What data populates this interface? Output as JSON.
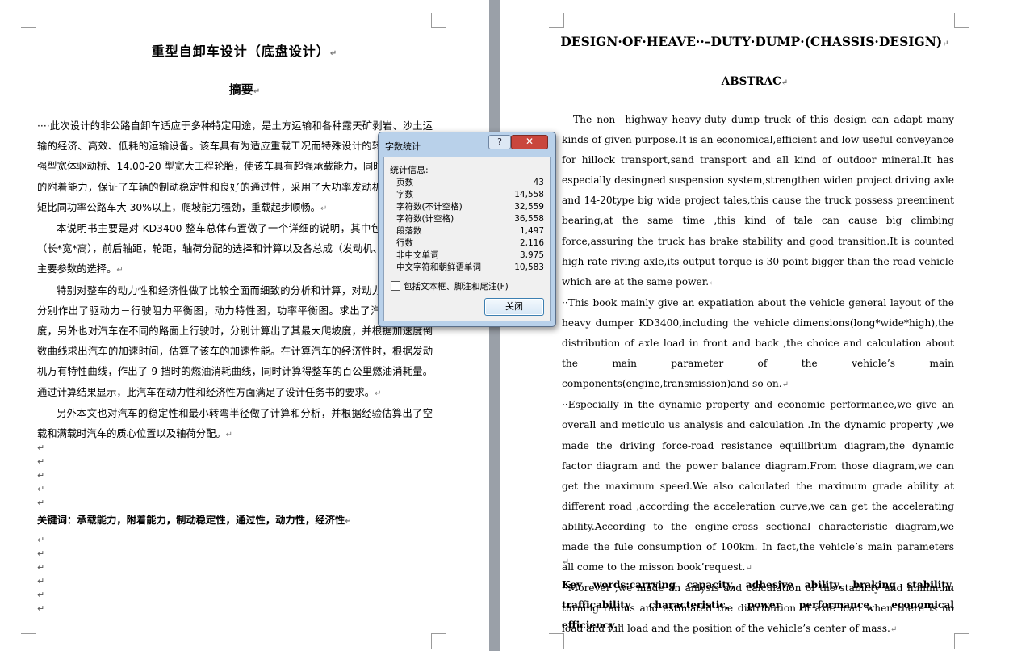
{
  "left_page": {
    "title": "重型自卸车设计（底盘设计）",
    "abstract_heading": "摘要",
    "paragraphs": [
      "····此次设计的非公路自卸车适应于多种特定用途，是土方运输和各种露天矿剥岩、沙土运输的经济、高效、低耗的运输设备。该车具有为适应重载工况而特殊设计的转向系统、加强型宽体驱动桥、14.00-20 型宽大工程轮胎，使该车具有超强承载能力，同时提供了超强的附着能力，保证了车辆的制动稳定性和良好的通过性，采用了大功率发动机，其输出转矩比同功率公路车大 30%以上，爬坡能力强劲，重载起步顺畅。",
      "本说明书主要是对 KD3400 整车总体布置做了一个详细的说明，其中包括整车尺寸（长*宽*高），前后轴距，轮距，轴荷分配的选择和计算以及各总成（发动机、传动系）的主要参数的选择。",
      "特别对整车的动力性和经济性做了比较全面而细致的分析和计算，对动力性计算时，分别作出了驱动力－行驶阻力平衡图，动力特性图，功率平衡图。求出了汽车的最大速度，另外也对汽车在不同的路面上行驶时，分别计算出了其最大爬坡度，并根据加速度倒数曲线求出汽车的加速时间，估算了该车的加速性能。在计算汽车的经济性时，根据发动机万有特性曲线，作出了 9 挡时的燃油消耗曲线，同时计算得整车的百公里燃油消耗量。通过计算结果显示，此汽车在动力性和经济性方面满足了设计任务书的要求。",
      "另外本文也对汽车的稳定性和最小转弯半径做了计算和分析，并根据经验估算出了空载和满载时汽车的质心位置以及轴荷分配。"
    ],
    "keywords": "关键词：承载能力，附着能力，制动稳定性，通过性，动力性，经济性"
  },
  "right_page": {
    "title": "DESIGN·OF·HEAVE··–DUTY·DUMP·(CHASSIS·DESIGN)",
    "abstract_heading": "ABSTRAC",
    "paragraphs": [
      "The non –highway heavy-duty dump truck of this design can adapt many kinds of given purpose.It is an economical,efficient and low useful conveyance for hillock transport,sand transport and all kind of outdoor mineral.It has especially desingned suspension system,strengthen widen project driving axle and 14-20type big wide project tales,this cause the truck possess preeminent bearing,at the same time ,this kind of tale can cause big climbing force,assuring the truck has brake stability and good transition.It is counted high rate riving axle,its output torque is 30 point bigger than the road vehicle which are at the same power.",
      "··This book mainly give an expatiation about the vehicle general layout of the heavy dumper KD3400,including the vehicle dimensions(long*wide*high),the distribution of axle load in front and back ,the choice and calculation about the main parameter of the vehicle’s main components(engine,transmission)and so on.",
      "··Especially in the dynamic property and economic performance,we give an overall and meticulo us analysis and calculation .In the dynamic property ,we made the driving force-road resistance equilibrium diagram,the dynamic factor diagram and the power balance diagram.From those diagram,we can get the maximum speed.We also calculated the maximum grade ability at different road ,according the acceleration curve,we can get the accelerating ability.According to the engine-cross sectional characteristic diagram,we made the fule consumption of 100km. In fact,the vehicle’s main parameters all come to the misson book’request.",
      "··Morever ,we made an anlysis and calculation of the stability and minimum turning radius and estimated the distribution of axle load when there is no load and full load and the position of the vehicle’s center of mass."
    ],
    "keywords": "Key words:carrying capacity, adhesive ability, braking stability, trafficability characteristic, power performance, economical efficiency."
  },
  "dialog": {
    "title": "字数统计",
    "help_label": "?",
    "close_x": "✕",
    "section": "统计信息:",
    "stats": [
      {
        "label": "页数",
        "value": "43"
      },
      {
        "label": "字数",
        "value": "14,558"
      },
      {
        "label": "字符数(不计空格)",
        "value": "32,559"
      },
      {
        "label": "字符数(计空格)",
        "value": "36,558"
      },
      {
        "label": "段落数",
        "value": "1,497"
      },
      {
        "label": "行数",
        "value": "2,116"
      },
      {
        "label": "非中文单词",
        "value": "3,975"
      },
      {
        "label": "中文字符和朝鲜语单词",
        "value": "10,583"
      }
    ],
    "checkbox_label": "包括文本框、脚注和尾注(F)",
    "close_button": "关闭"
  },
  "paragraph_mark": "↵"
}
